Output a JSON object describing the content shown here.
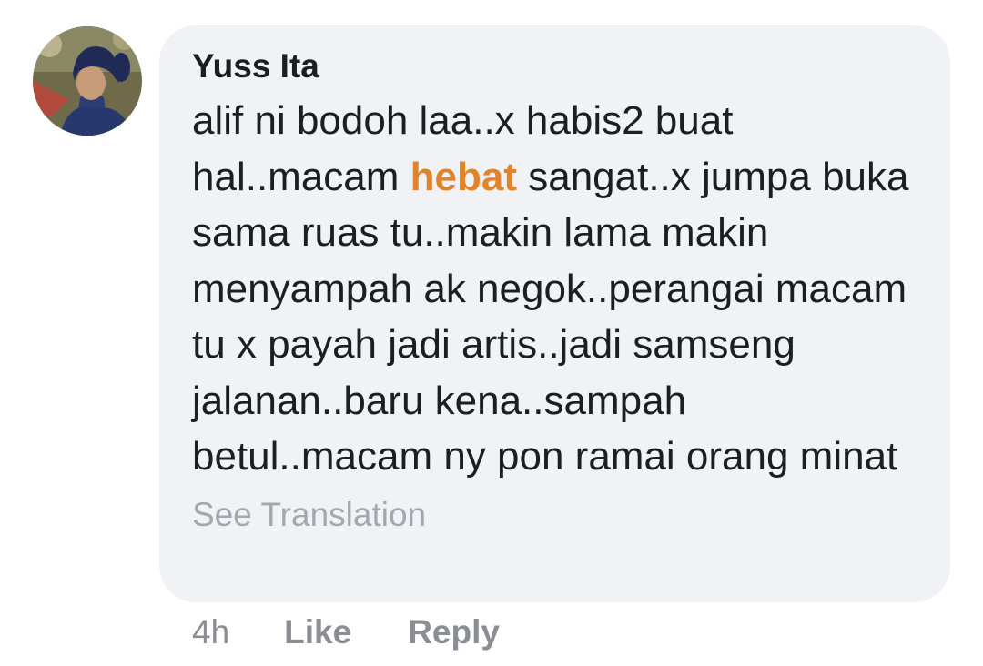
{
  "comment": {
    "author": "Yuss Ita",
    "text_before": "alif ni bodoh laa..x habis2 buat hal..macam ",
    "highlight": "hebat",
    "text_after": " sangat..x jumpa buka sama ruas tu..makin lama makin menyampah ak negok..perangai macam tu x payah jadi artis..jadi samseng jalanan..baru kena..sampah betul..macam ny pon ramai orang minat",
    "see_translation": "See Translation",
    "timestamp": "4h",
    "like_label": "Like",
    "reply_label": "Reply"
  },
  "colors": {
    "bubble_bg": "#f0f2f5",
    "text": "#1c1e21",
    "highlight": "#e0832a",
    "muted": "#8a8d91"
  }
}
